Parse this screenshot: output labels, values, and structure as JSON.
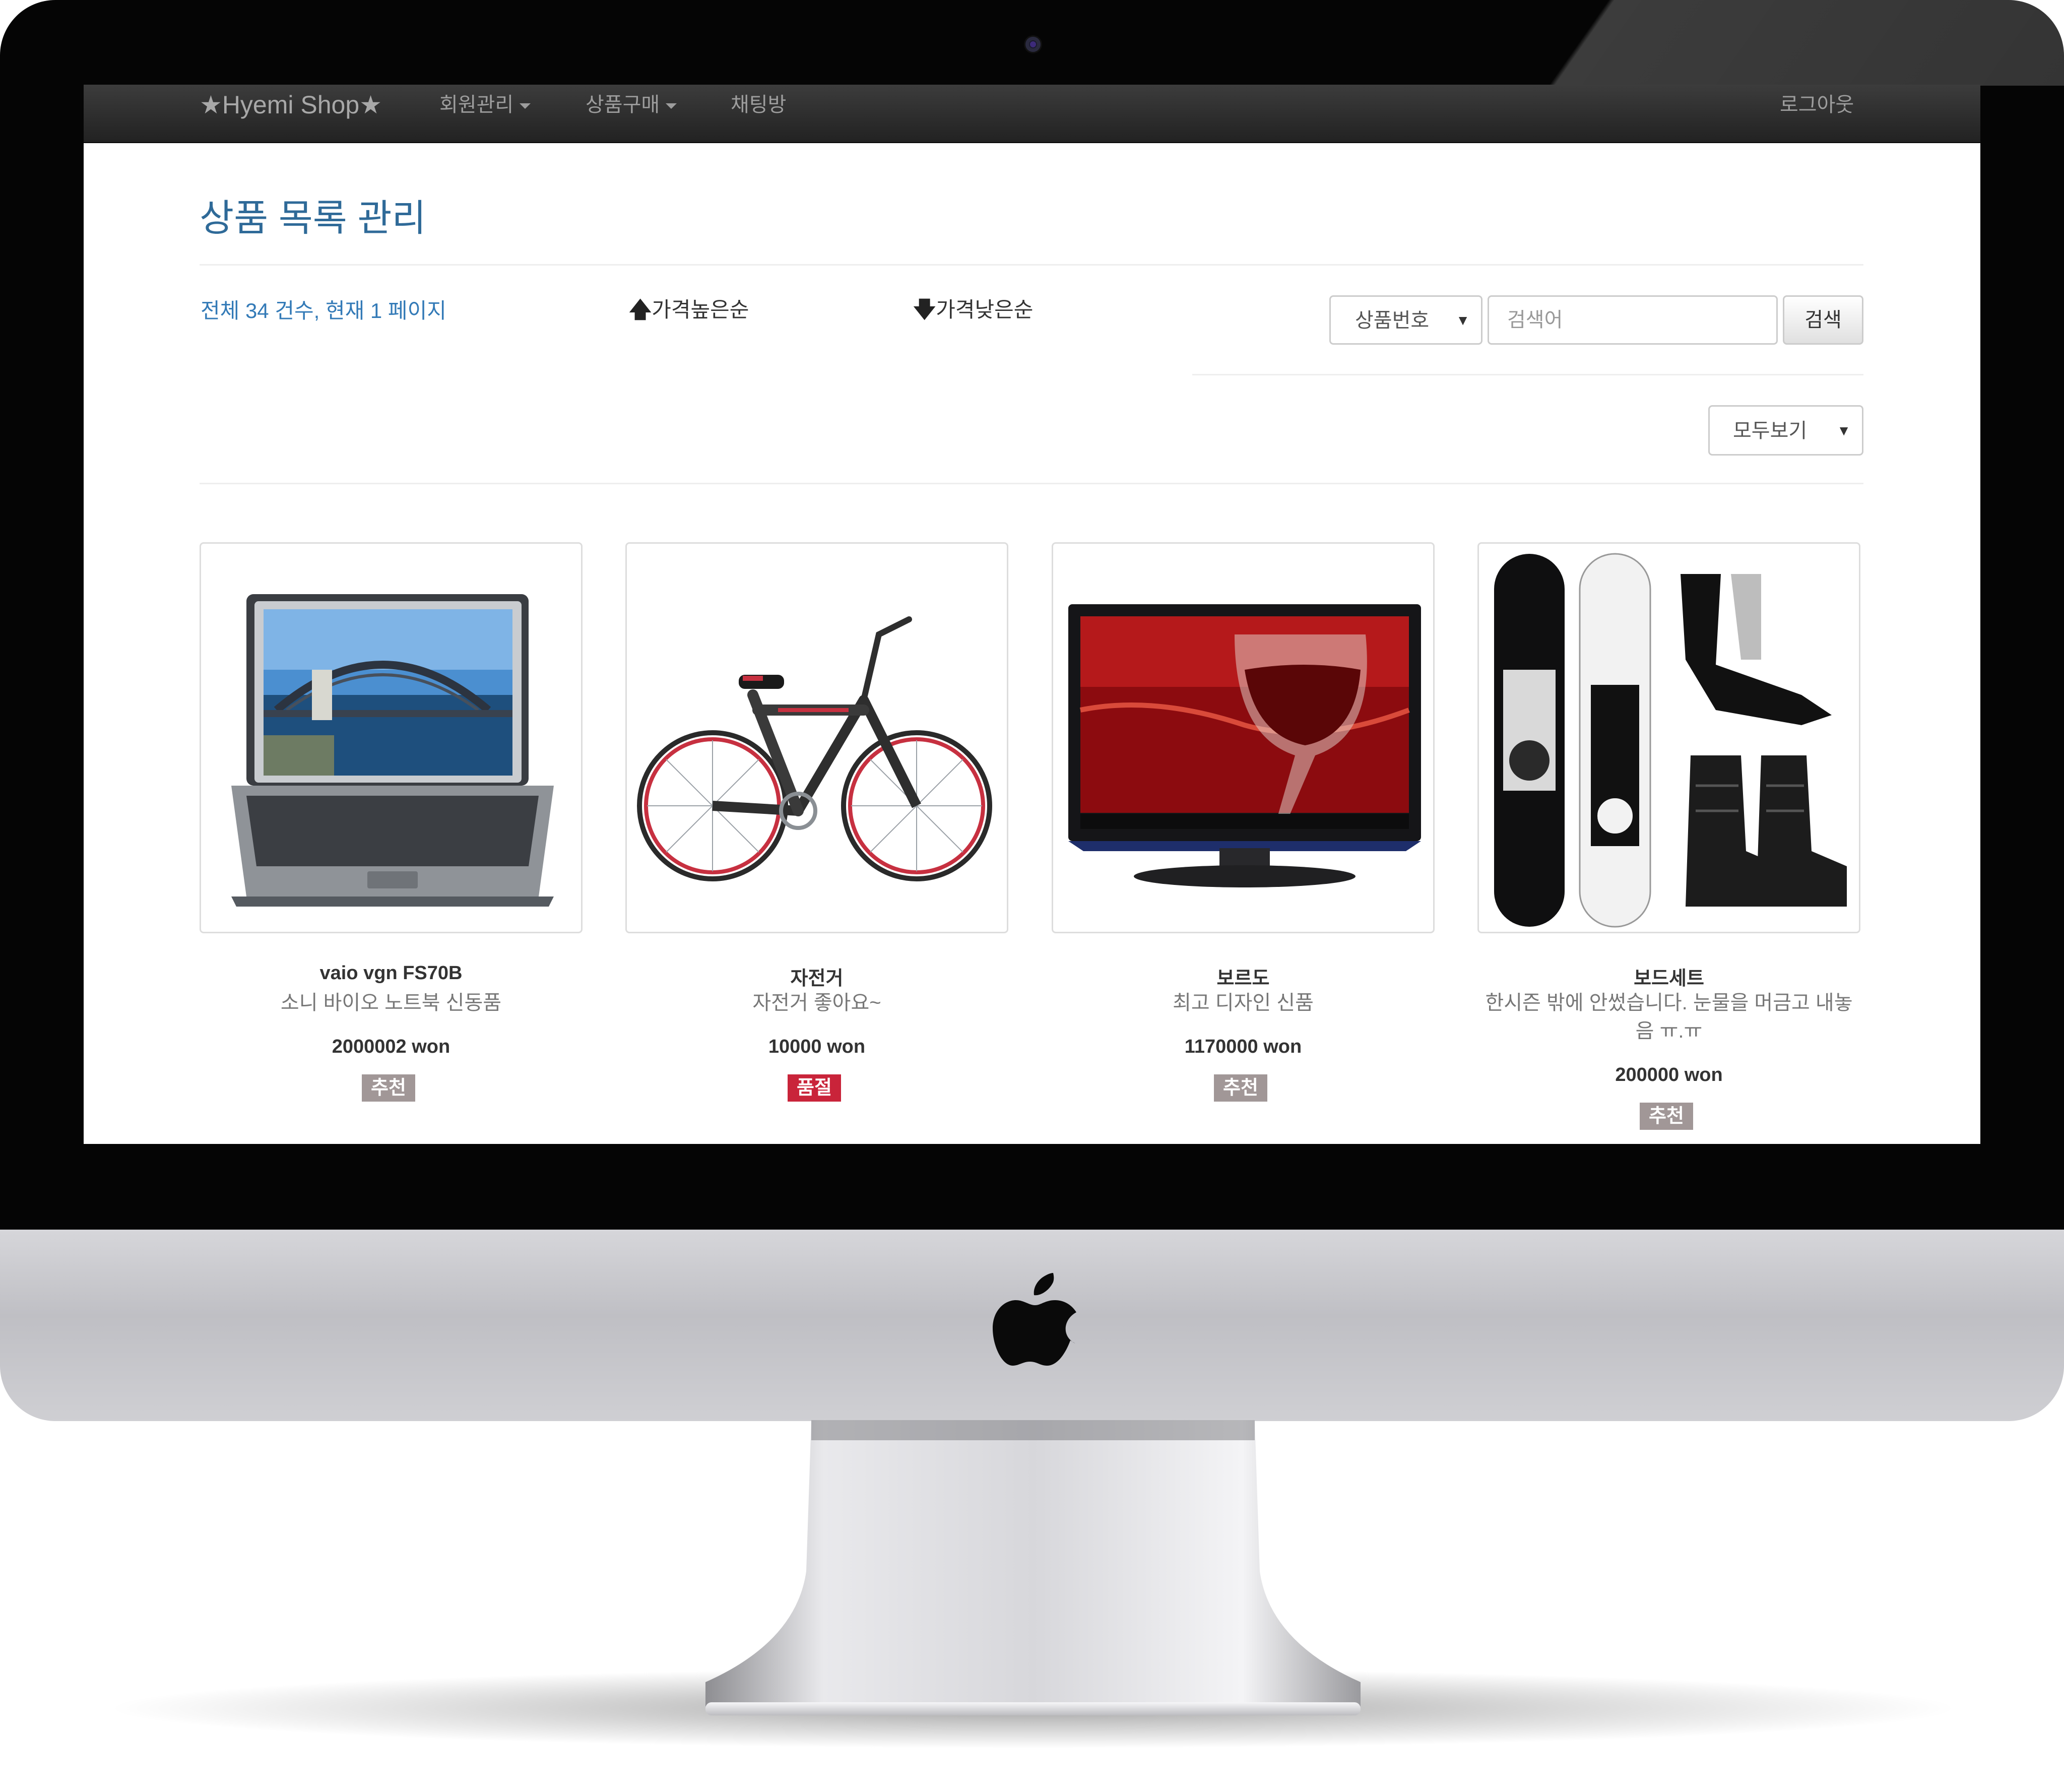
{
  "navbar": {
    "brand": "★Hyemi Shop★",
    "members_menu": "회원관리",
    "shop_menu": "상품구매",
    "chat_link": "채팅방",
    "logout_link": "로그아웃"
  },
  "page": {
    "title": "상품 목록 관리",
    "summary": "전체 34 건수, 현재 1 페이지"
  },
  "sort": {
    "high_arrow": "🡅",
    "high_label": "가격높은순",
    "low_arrow": "🡇",
    "low_label": "가격낮은순"
  },
  "search": {
    "field_selected": "상품번호",
    "placeholder": "검색어",
    "button_label": "검색"
  },
  "filter": {
    "selected": "모두보기"
  },
  "colors": {
    "recommend_badge": "#a19797",
    "soldout_badge": "#c9243a",
    "title_blue": "#2f6a98",
    "link_blue": "#337ab7"
  },
  "products": [
    {
      "name": "vaio vgn FS70B",
      "desc": "소니 바이오 노트북 신동품",
      "price": "2000002 won",
      "badge": "추천",
      "image": "laptop-image"
    },
    {
      "name": "자전거",
      "desc": "자전거 좋아요~",
      "price": "10000 won",
      "badge": "품절",
      "image": "bicycle-image"
    },
    {
      "name": "보르도",
      "desc": "최고 디자인 신품",
      "price": "1170000 won",
      "badge": "추천",
      "image": "tv-image"
    },
    {
      "name": "보드세트",
      "desc": "한시즌 밖에 안썼습니다. 눈물을 머금고 내놓음 ㅠ.ㅠ",
      "price": "200000 won",
      "badge": "추천",
      "image": "snowboard-set-image"
    }
  ]
}
